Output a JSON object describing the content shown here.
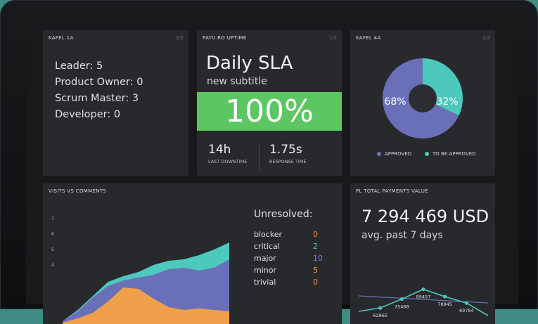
{
  "tiles": {
    "team": {
      "title": "KAFEL 1A",
      "page": "1/2",
      "roles": [
        "Leader: 5",
        "Product Owner: 0",
        "Scrum Master: 3",
        "Developer: 0"
      ]
    },
    "uptime": {
      "title": "PAYU.RO UPTIME",
      "page": "1/2",
      "heading": "Daily SLA",
      "subtitle": "new subtitle",
      "value": "100%",
      "downtime_value": "14h",
      "downtime_label": "LAST DOWNTIME",
      "response_value": "1.75s",
      "response_label": "RESPONSE TIME",
      "band_color": "#5cc762"
    },
    "approval": {
      "title": "KAFEL 4A",
      "page": "1/2",
      "approved_pct": "68%",
      "to_approve_pct": "32%",
      "approved_label": "APPROVED",
      "to_approve_label": "TO BE APPROVED",
      "approved_fraction": 0.68,
      "approved_color": "#6a70b8",
      "to_approve_color": "#4dc8bd"
    },
    "visits": {
      "title": "VISITS VS COMMENTS",
      "unresolved_title": "Unresolved:",
      "unresolved": [
        {
          "label": "blocker",
          "count": "0",
          "color": "#f08a4b"
        },
        {
          "label": "critical",
          "count": "2",
          "color": "#4dc8bd"
        },
        {
          "label": "major",
          "count": "10",
          "color": "#7b80c8"
        },
        {
          "label": "minor",
          "count": "5",
          "color": "#f0a04b"
        },
        {
          "label": "trivial",
          "count": "0",
          "color": "#f08a4b"
        }
      ]
    },
    "payments": {
      "title": "PL TOTAL PAYMENTS VALUE",
      "value": "7 294 469 USD",
      "subtitle": "avg. past 7 days",
      "point_labels": [
        "62865",
        "75468",
        "89457",
        "78945",
        "69784"
      ]
    }
  },
  "chart_data": [
    {
      "type": "area",
      "title": "VISITS VS COMMENTS",
      "yticks": [
        4,
        5,
        6,
        7
      ],
      "x": [
        0,
        1,
        2,
        3,
        4,
        5,
        6,
        7,
        8,
        9,
        10,
        11
      ],
      "series": [
        {
          "values": [
            0.2,
            1.0,
            2.0,
            3.0,
            3.4,
            3.7,
            4.2,
            4.5,
            4.6,
            4.9,
            5.3,
            5.8
          ],
          "color": "#4dc8bd"
        },
        {
          "values": [
            0.2,
            0.9,
            1.9,
            2.7,
            3.1,
            3.3,
            3.5,
            3.9,
            4.0,
            3.8,
            4.0,
            4.6
          ],
          "color": "#6a70b8"
        },
        {
          "values": [
            0.1,
            0.4,
            0.8,
            1.6,
            2.6,
            2.5,
            1.8,
            1.2,
            1.0,
            1.1,
            1.0,
            0.9
          ],
          "color": "#f0a04b"
        }
      ]
    },
    {
      "type": "line",
      "title": "PL TOTAL PAYMENTS VALUE",
      "x": [
        0,
        1,
        2,
        3,
        4,
        5,
        6
      ],
      "values": [
        58000,
        62865,
        75468,
        89457,
        78945,
        69784,
        52000
      ],
      "point_labels": [
        "",
        "62865",
        "75468",
        "89457",
        "78945",
        "69784",
        ""
      ],
      "color": "#4dc8bd"
    }
  ]
}
